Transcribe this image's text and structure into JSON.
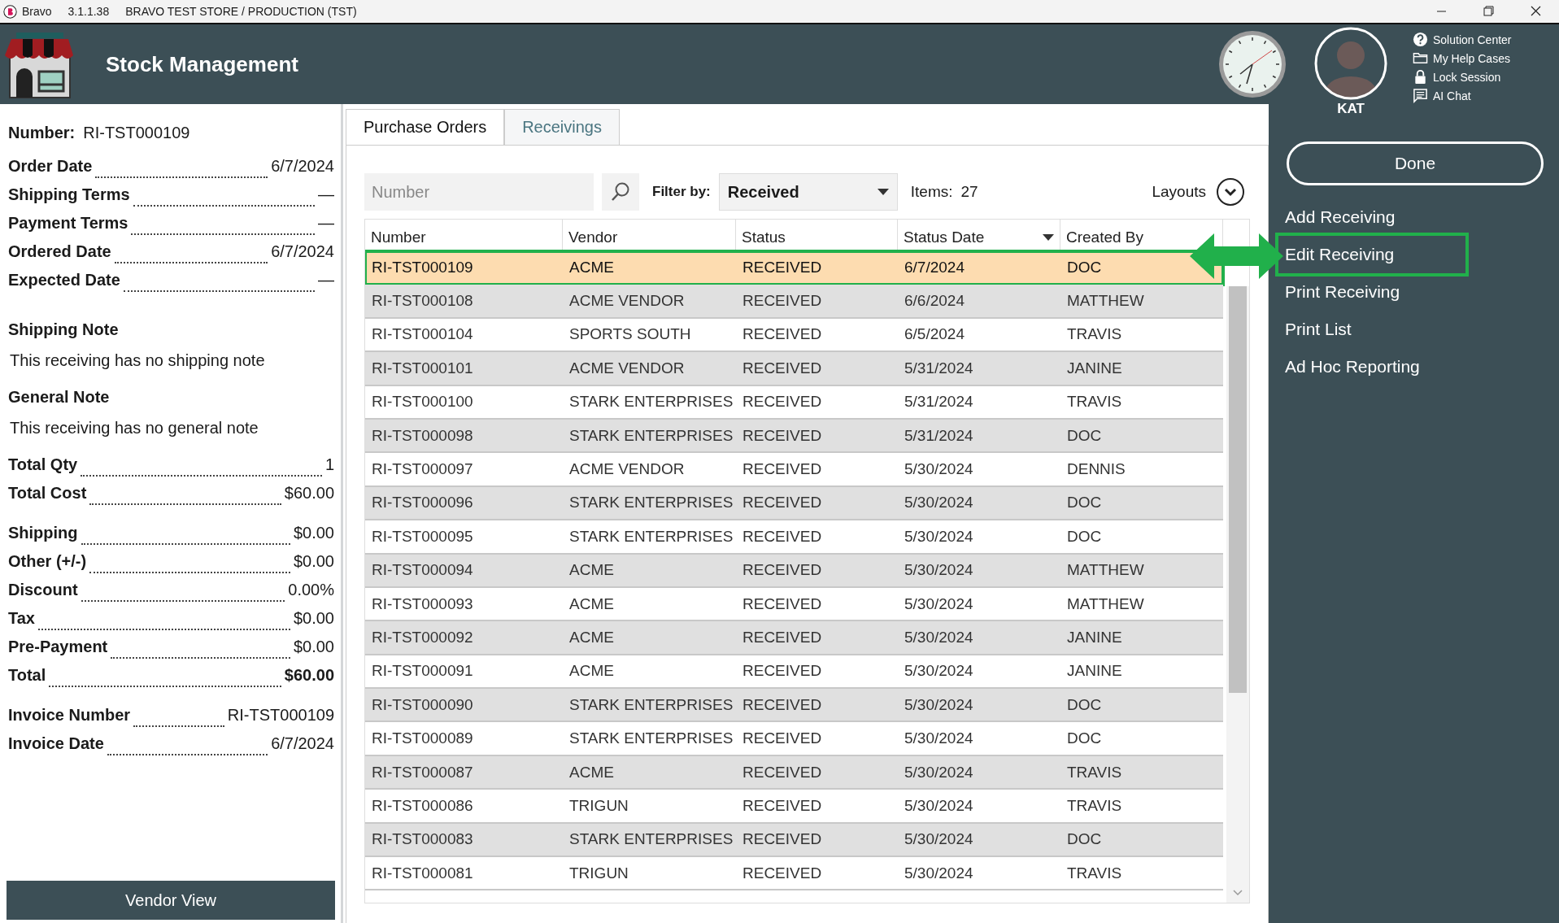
{
  "title_bar": {
    "app": "Bravo",
    "version": "3.1.1.38",
    "store": "BRAVO TEST STORE / PRODUCTION (TST)"
  },
  "header": {
    "title": "Stock Management",
    "user": "KAT",
    "links": [
      {
        "label": "Solution Center",
        "kind": "help"
      },
      {
        "label": "My Help Cases",
        "kind": "folder"
      },
      {
        "label": "Lock Session",
        "kind": "lock"
      },
      {
        "label": "AI Chat",
        "kind": "chat"
      }
    ]
  },
  "details": {
    "number_label": "Number:",
    "number": "RI-TST000109",
    "groups": [
      [
        {
          "label": "Order Date",
          "value": "6/7/2024",
          "emphasis": false
        },
        {
          "label": "Shipping Terms",
          "value": "—",
          "emphasis": false
        },
        {
          "label": "Payment Terms",
          "value": "—",
          "emphasis": false
        },
        {
          "label": "Ordered Date",
          "value": "6/7/2024",
          "emphasis": false
        },
        {
          "label": "Expected Date",
          "value": "—",
          "emphasis": false
        }
      ],
      [
        {
          "label": "Total Qty",
          "value": "1",
          "emphasis": false
        },
        {
          "label": "Total Cost",
          "value": "$60.00",
          "emphasis": false
        }
      ],
      [
        {
          "label": "Shipping",
          "value": "$0.00",
          "emphasis": false
        },
        {
          "label": "Other (+/-)",
          "value": "$0.00",
          "emphasis": false
        },
        {
          "label": "Discount",
          "value": "0.00%",
          "emphasis": false
        },
        {
          "label": "Tax",
          "value": "$0.00",
          "emphasis": false
        },
        {
          "label": "Pre-Payment",
          "value": "$0.00",
          "emphasis": false
        },
        {
          "label": "Total",
          "value": "$60.00",
          "emphasis": true
        }
      ],
      [
        {
          "label": "Invoice Number",
          "value": "RI-TST000109",
          "emphasis": false
        },
        {
          "label": "Invoice Date",
          "value": "6/7/2024",
          "emphasis": false
        }
      ]
    ],
    "notes": [
      {
        "title": "Shipping Note",
        "text": "This receiving has no shipping note"
      },
      {
        "title": "General Note",
        "text": "This receiving has no general note"
      }
    ],
    "vendor_view_button": "Vendor View"
  },
  "tabs": [
    {
      "label": "Purchase Orders",
      "selected": false
    },
    {
      "label": "Receivings",
      "selected": true
    }
  ],
  "search": {
    "placeholder": "Number"
  },
  "filter": {
    "label": "Filter by:",
    "value": "Received"
  },
  "items": {
    "label": "Items:",
    "count": "27"
  },
  "layouts": "Layouts",
  "table": {
    "columns": [
      {
        "label": "Number",
        "sorted": false
      },
      {
        "label": "Vendor",
        "sorted": false
      },
      {
        "label": "Status",
        "sorted": false
      },
      {
        "label": "Status Date",
        "sorted": true
      },
      {
        "label": "Created By",
        "sorted": false
      }
    ],
    "rows": [
      {
        "selected": true,
        "highlighted": true,
        "cells": [
          "RI-TST000109",
          "ACME",
          "RECEIVED",
          "6/7/2024",
          "DOC"
        ]
      },
      {
        "selected": false,
        "highlighted": false,
        "cells": [
          "RI-TST000108",
          "ACME VENDOR",
          "RECEIVED",
          "6/6/2024",
          "MATTHEW"
        ]
      },
      {
        "selected": false,
        "highlighted": false,
        "cells": [
          "RI-TST000104",
          "SPORTS SOUTH",
          "RECEIVED",
          "6/5/2024",
          "TRAVIS"
        ]
      },
      {
        "selected": false,
        "highlighted": false,
        "cells": [
          "RI-TST000101",
          "ACME VENDOR",
          "RECEIVED",
          "5/31/2024",
          "JANINE"
        ]
      },
      {
        "selected": false,
        "highlighted": false,
        "cells": [
          "RI-TST000100",
          "STARK ENTERPRISES",
          "RECEIVED",
          "5/31/2024",
          "TRAVIS"
        ]
      },
      {
        "selected": false,
        "highlighted": false,
        "cells": [
          "RI-TST000098",
          "STARK ENTERPRISES",
          "RECEIVED",
          "5/31/2024",
          "DOC"
        ]
      },
      {
        "selected": false,
        "highlighted": false,
        "cells": [
          "RI-TST000097",
          "ACME VENDOR",
          "RECEIVED",
          "5/30/2024",
          "DENNIS"
        ]
      },
      {
        "selected": false,
        "highlighted": false,
        "cells": [
          "RI-TST000096",
          "STARK ENTERPRISES",
          "RECEIVED",
          "5/30/2024",
          "DOC"
        ]
      },
      {
        "selected": false,
        "highlighted": false,
        "cells": [
          "RI-TST000095",
          "STARK ENTERPRISES",
          "RECEIVED",
          "5/30/2024",
          "DOC"
        ]
      },
      {
        "selected": false,
        "highlighted": false,
        "cells": [
          "RI-TST000094",
          "ACME",
          "RECEIVED",
          "5/30/2024",
          "MATTHEW"
        ]
      },
      {
        "selected": false,
        "highlighted": false,
        "cells": [
          "RI-TST000093",
          "ACME",
          "RECEIVED",
          "5/30/2024",
          "MATTHEW"
        ]
      },
      {
        "selected": false,
        "highlighted": false,
        "cells": [
          "RI-TST000092",
          "ACME",
          "RECEIVED",
          "5/30/2024",
          "JANINE"
        ]
      },
      {
        "selected": false,
        "highlighted": false,
        "cells": [
          "RI-TST000091",
          "ACME",
          "RECEIVED",
          "5/30/2024",
          "JANINE"
        ]
      },
      {
        "selected": false,
        "highlighted": false,
        "cells": [
          "RI-TST000090",
          "STARK ENTERPRISES",
          "RECEIVED",
          "5/30/2024",
          "DOC"
        ]
      },
      {
        "selected": false,
        "highlighted": false,
        "cells": [
          "RI-TST000089",
          "STARK ENTERPRISES",
          "RECEIVED",
          "5/30/2024",
          "DOC"
        ]
      },
      {
        "selected": false,
        "highlighted": false,
        "cells": [
          "RI-TST000087",
          "ACME",
          "RECEIVED",
          "5/30/2024",
          "TRAVIS"
        ]
      },
      {
        "selected": false,
        "highlighted": false,
        "cells": [
          "RI-TST000086",
          "TRIGUN",
          "RECEIVED",
          "5/30/2024",
          "TRAVIS"
        ]
      },
      {
        "selected": false,
        "highlighted": false,
        "cells": [
          "RI-TST000083",
          "STARK ENTERPRISES",
          "RECEIVED",
          "5/30/2024",
          "DOC"
        ]
      },
      {
        "selected": false,
        "highlighted": false,
        "cells": [
          "RI-TST000081",
          "TRIGUN",
          "RECEIVED",
          "5/30/2024",
          "TRAVIS"
        ]
      }
    ]
  },
  "sidebar": {
    "done": "Done",
    "actions": [
      {
        "label": "Add Receiving",
        "highlighted": false
      },
      {
        "label": "Edit Receiving",
        "highlighted": true
      },
      {
        "label": "Print Receiving",
        "highlighted": false
      },
      {
        "label": "Print List",
        "highlighted": false
      },
      {
        "label": "Ad Hoc Reporting",
        "highlighted": false
      }
    ]
  }
}
